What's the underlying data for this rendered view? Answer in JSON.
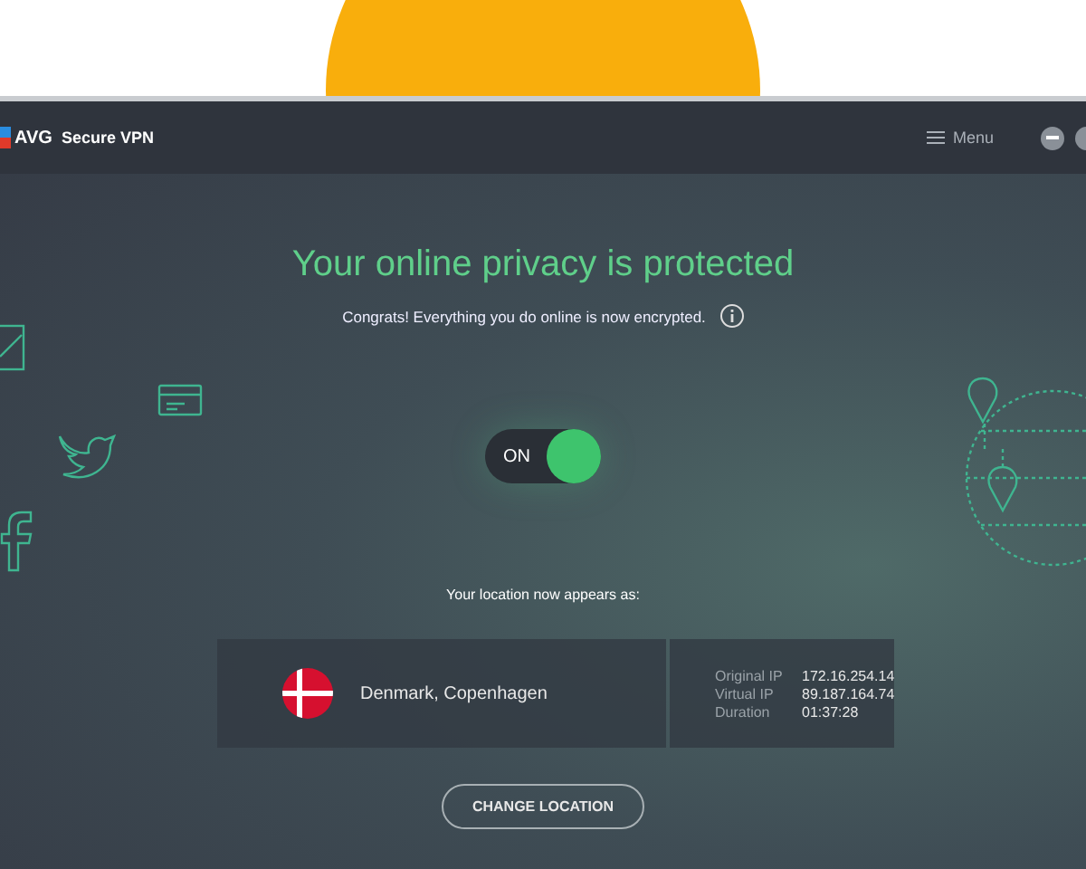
{
  "app": {
    "logo": "AVG",
    "name": "Secure VPN",
    "menu": "Menu"
  },
  "status": {
    "headline": "Your online privacy is protected",
    "subtext": "Congrats! Everything you do online is now encrypted."
  },
  "toggle": {
    "label": "ON",
    "on": true
  },
  "location": {
    "caption": "Your location now appears as:",
    "place": "Denmark, Copenhagen",
    "details": [
      {
        "label": "Original IP",
        "value": "172.16.254.14"
      },
      {
        "label": "Virtual IP",
        "value": "89.187.164.74"
      },
      {
        "label": "Duration",
        "value": "01:37:28"
      }
    ]
  },
  "button": "CHANGE LOCATION"
}
